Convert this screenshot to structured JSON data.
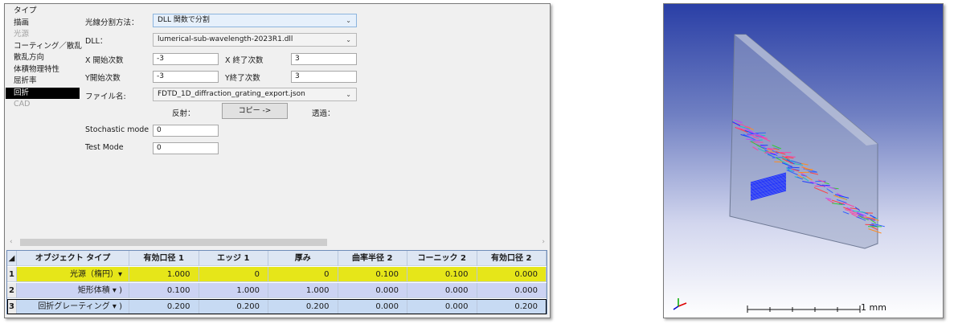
{
  "nav": {
    "items": [
      {
        "label": "タイプ",
        "state": "normal"
      },
      {
        "label": "描画",
        "state": "normal"
      },
      {
        "label": "光源",
        "state": "disabled"
      },
      {
        "label": "コーティング／散乱",
        "state": "normal"
      },
      {
        "label": "散乱方向",
        "state": "normal"
      },
      {
        "label": "体積物理特性",
        "state": "normal"
      },
      {
        "label": "屈折率",
        "state": "normal"
      },
      {
        "label": "回折",
        "state": "selected"
      },
      {
        "label": "CAD",
        "state": "disabled"
      }
    ]
  },
  "form": {
    "split_method_label": "光線分割方法：",
    "split_method_value": "DLL 関数で分割",
    "dll_label": "DLL：",
    "dll_value": "lumerical-sub-wavelength-2023R1.dll",
    "x_start_label": "X 開始次数",
    "x_start_value": "-3",
    "x_end_label": "X 終了次数",
    "x_end_value": "3",
    "y_start_label": "Y開始次数",
    "y_start_value": "-3",
    "y_end_label": "Y終了次数",
    "y_end_value": "3",
    "file_label": "ファイル名:",
    "file_value": "FDTD_1D_diffraction_grating_export.json",
    "reflect_label": "反射：",
    "copy_button": "コピー ->",
    "transmit_label": "透過：",
    "stochastic_label": "Stochastic mode",
    "stochastic_value": "0",
    "test_mode_label": "Test Mode",
    "test_mode_value": "0"
  },
  "grid": {
    "headers": [
      "オブジェクト タイプ",
      "有効口径 1",
      "エッジ 1",
      "厚み",
      "曲率半径 2",
      "コーニック 2",
      "有効口径 2"
    ],
    "rows": [
      {
        "num": "1",
        "type": "光源（楕円）▾ ",
        "values": [
          "1.000",
          "0",
          "0",
          "0.100",
          "0.100",
          "0.000"
        ],
        "color": "#e6e619"
      },
      {
        "num": "2",
        "type": "矩形体積 ▾ )",
        "values": [
          "0.100",
          "1.000",
          "1.000",
          "0.000",
          "0.000",
          "0.000"
        ],
        "color": "#ccd3f3"
      },
      {
        "num": "3",
        "type": "回折グレーティング ▾ )",
        "values": [
          "0.200",
          "0.200",
          "0.200",
          "0.000",
          "0.000",
          "0.200"
        ],
        "color": "#c7daf3"
      }
    ]
  },
  "viewer": {
    "scale_label": "1 mm"
  }
}
